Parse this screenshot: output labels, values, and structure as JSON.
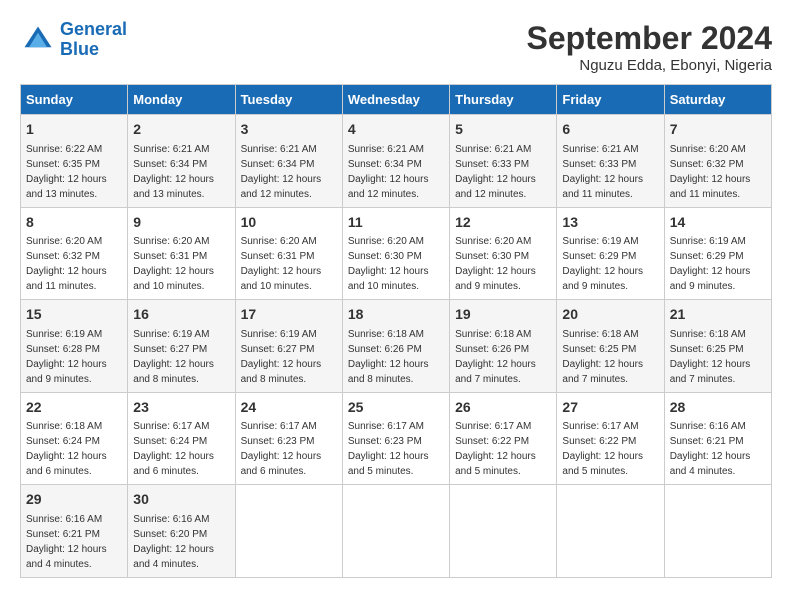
{
  "logo": {
    "line1": "General",
    "line2": "Blue"
  },
  "title": "September 2024",
  "location": "Nguzu Edda, Ebonyi, Nigeria",
  "days_of_week": [
    "Sunday",
    "Monday",
    "Tuesday",
    "Wednesday",
    "Thursday",
    "Friday",
    "Saturday"
  ],
  "weeks": [
    [
      {
        "day": "1",
        "sunrise": "6:22 AM",
        "sunset": "6:35 PM",
        "daylight": "12 hours and 13 minutes."
      },
      {
        "day": "2",
        "sunrise": "6:21 AM",
        "sunset": "6:34 PM",
        "daylight": "12 hours and 13 minutes."
      },
      {
        "day": "3",
        "sunrise": "6:21 AM",
        "sunset": "6:34 PM",
        "daylight": "12 hours and 12 minutes."
      },
      {
        "day": "4",
        "sunrise": "6:21 AM",
        "sunset": "6:34 PM",
        "daylight": "12 hours and 12 minutes."
      },
      {
        "day": "5",
        "sunrise": "6:21 AM",
        "sunset": "6:33 PM",
        "daylight": "12 hours and 12 minutes."
      },
      {
        "day": "6",
        "sunrise": "6:21 AM",
        "sunset": "6:33 PM",
        "daylight": "12 hours and 11 minutes."
      },
      {
        "day": "7",
        "sunrise": "6:20 AM",
        "sunset": "6:32 PM",
        "daylight": "12 hours and 11 minutes."
      }
    ],
    [
      {
        "day": "8",
        "sunrise": "6:20 AM",
        "sunset": "6:32 PM",
        "daylight": "12 hours and 11 minutes."
      },
      {
        "day": "9",
        "sunrise": "6:20 AM",
        "sunset": "6:31 PM",
        "daylight": "12 hours and 10 minutes."
      },
      {
        "day": "10",
        "sunrise": "6:20 AM",
        "sunset": "6:31 PM",
        "daylight": "12 hours and 10 minutes."
      },
      {
        "day": "11",
        "sunrise": "6:20 AM",
        "sunset": "6:30 PM",
        "daylight": "12 hours and 10 minutes."
      },
      {
        "day": "12",
        "sunrise": "6:20 AM",
        "sunset": "6:30 PM",
        "daylight": "12 hours and 9 minutes."
      },
      {
        "day": "13",
        "sunrise": "6:19 AM",
        "sunset": "6:29 PM",
        "daylight": "12 hours and 9 minutes."
      },
      {
        "day": "14",
        "sunrise": "6:19 AM",
        "sunset": "6:29 PM",
        "daylight": "12 hours and 9 minutes."
      }
    ],
    [
      {
        "day": "15",
        "sunrise": "6:19 AM",
        "sunset": "6:28 PM",
        "daylight": "12 hours and 9 minutes."
      },
      {
        "day": "16",
        "sunrise": "6:19 AM",
        "sunset": "6:27 PM",
        "daylight": "12 hours and 8 minutes."
      },
      {
        "day": "17",
        "sunrise": "6:19 AM",
        "sunset": "6:27 PM",
        "daylight": "12 hours and 8 minutes."
      },
      {
        "day": "18",
        "sunrise": "6:18 AM",
        "sunset": "6:26 PM",
        "daylight": "12 hours and 8 minutes."
      },
      {
        "day": "19",
        "sunrise": "6:18 AM",
        "sunset": "6:26 PM",
        "daylight": "12 hours and 7 minutes."
      },
      {
        "day": "20",
        "sunrise": "6:18 AM",
        "sunset": "6:25 PM",
        "daylight": "12 hours and 7 minutes."
      },
      {
        "day": "21",
        "sunrise": "6:18 AM",
        "sunset": "6:25 PM",
        "daylight": "12 hours and 7 minutes."
      }
    ],
    [
      {
        "day": "22",
        "sunrise": "6:18 AM",
        "sunset": "6:24 PM",
        "daylight": "12 hours and 6 minutes."
      },
      {
        "day": "23",
        "sunrise": "6:17 AM",
        "sunset": "6:24 PM",
        "daylight": "12 hours and 6 minutes."
      },
      {
        "day": "24",
        "sunrise": "6:17 AM",
        "sunset": "6:23 PM",
        "daylight": "12 hours and 6 minutes."
      },
      {
        "day": "25",
        "sunrise": "6:17 AM",
        "sunset": "6:23 PM",
        "daylight": "12 hours and 5 minutes."
      },
      {
        "day": "26",
        "sunrise": "6:17 AM",
        "sunset": "6:22 PM",
        "daylight": "12 hours and 5 minutes."
      },
      {
        "day": "27",
        "sunrise": "6:17 AM",
        "sunset": "6:22 PM",
        "daylight": "12 hours and 5 minutes."
      },
      {
        "day": "28",
        "sunrise": "6:16 AM",
        "sunset": "6:21 PM",
        "daylight": "12 hours and 4 minutes."
      }
    ],
    [
      {
        "day": "29",
        "sunrise": "6:16 AM",
        "sunset": "6:21 PM",
        "daylight": "12 hours and 4 minutes."
      },
      {
        "day": "30",
        "sunrise": "6:16 AM",
        "sunset": "6:20 PM",
        "daylight": "12 hours and 4 minutes."
      },
      null,
      null,
      null,
      null,
      null
    ]
  ]
}
